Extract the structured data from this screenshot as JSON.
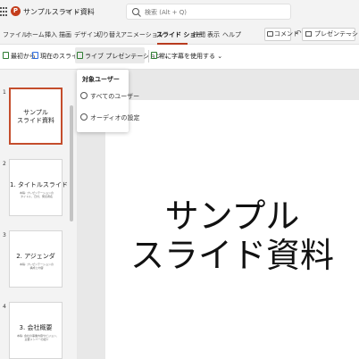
{
  "titlebar": {
    "app_letter": "P",
    "doc_title": "サンプルスライド資料",
    "doc_meta": "ᯤ ⌄",
    "search_placeholder": "検索 (Alt + Q)"
  },
  "menu": {
    "tabs": [
      "ファイル",
      "ホーム",
      "挿入",
      "描画",
      "デザイン",
      "切り替え",
      "アニメーション",
      "スライド ショー",
      "校閲",
      "表示",
      "ヘルプ"
    ],
    "active_tab": "スライド ショー",
    "comment_label": "コメント",
    "reply_icon": "↶",
    "present_label": "プレゼンテーション",
    "present_chevron": "⌄"
  },
  "ribbon": {
    "from_beginning": "最初から",
    "from_current": "現在のスライドから",
    "live_presentation": "ライブ プレゼンテーション ⌄",
    "always_subtitles": "常に字幕を使用する ⌄"
  },
  "dropdown": {
    "header": "対象ユーザー",
    "items": [
      "すべてのユーザー",
      "オーディオの設定"
    ]
  },
  "slides": [
    {
      "num": "1",
      "title": "サンプル\nスライド資料",
      "body": ""
    },
    {
      "num": "2",
      "title": "1. タイトルスライド",
      "body": "本稿: プレゼンテーションの\nタイトル、日付、発表者名"
    },
    {
      "num": "3",
      "title": "2. アジェンダ",
      "body": "本稿: プレゼンテーションの\n構成と内容"
    },
    {
      "num": "4",
      "title": "3. 会社概要",
      "body": "本稿: 会社の事業内容やビジョン、\n主要メンバーの紹介"
    }
  ],
  "main_slide": {
    "title_line1": "サンプル",
    "title_line2": "スライド資料"
  },
  "colors": {
    "accent": "#b83b1e",
    "brand": "#c43e1c"
  }
}
